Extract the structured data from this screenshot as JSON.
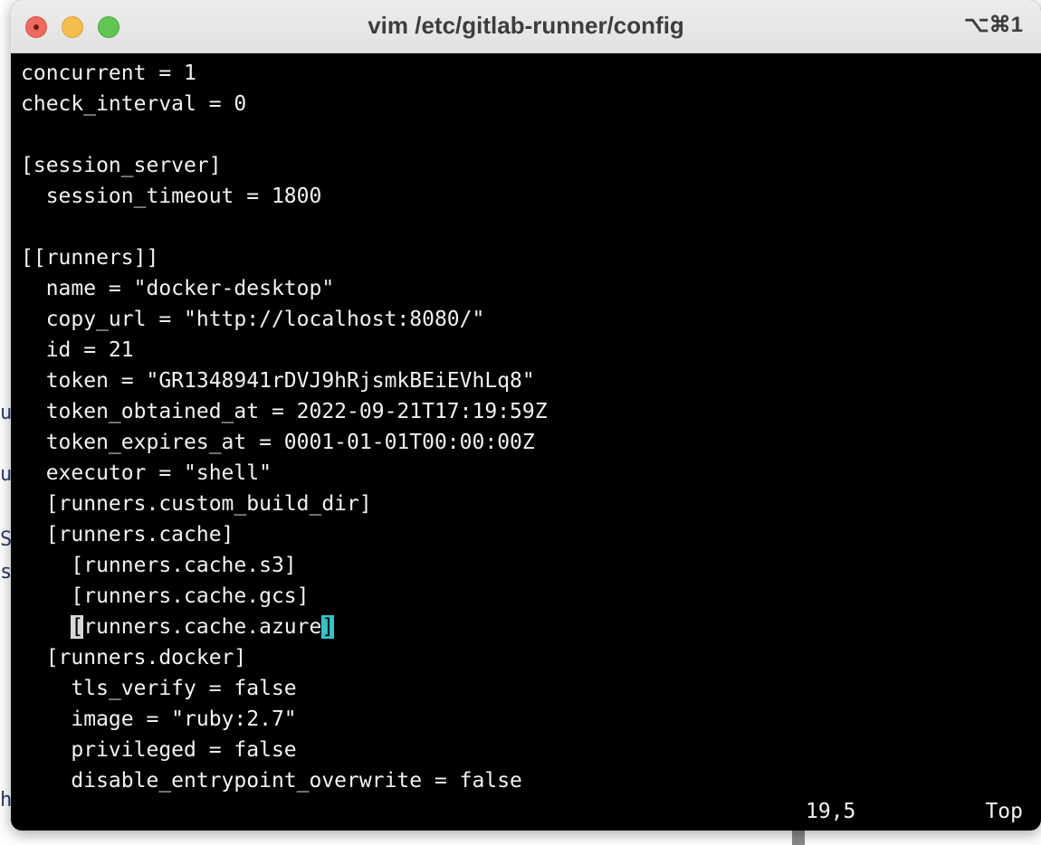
{
  "window": {
    "title": "vim /etc/gitlab-runner/config",
    "shortcut": "⌥⌘1"
  },
  "background": {
    "letters": [
      "u",
      "u",
      "S",
      "s",
      "h"
    ]
  },
  "editor": {
    "lines": [
      "concurrent = 1",
      "check_interval = 0",
      "",
      "[session_server]",
      "  session_timeout = 1800",
      "",
      "[[runners]]",
      "  name = \"docker-desktop\"",
      "  copy_url = \"http://localhost:8080/\"",
      "  id = 21",
      "  token = \"GR1348941rDVJ9hRjsmkBEiEVhLq8\"",
      "  token_obtained_at = 2022-09-21T17:19:59Z",
      "  token_expires_at = 0001-01-01T00:00:00Z",
      "  executor = \"shell\"",
      "  [runners.custom_build_dir]",
      "  [runners.cache]",
      "    [runners.cache.s3]",
      "    [runners.cache.gcs]",
      "",
      "  [runners.docker]",
      "    tls_verify = false",
      "    image = \"ruby:2.7\"",
      "    privileged = false",
      "    disable_entrypoint_overwrite = false"
    ],
    "cursor_line": {
      "indent": "    ",
      "cursor_char": "[",
      "middle": "runners.cache.azure",
      "match_char": "]"
    }
  },
  "status": {
    "position": "19,5",
    "scroll": "Top"
  },
  "colors": {
    "terminal_bg": "#000000",
    "text": "#f2f2f2",
    "cursor": "#d8d8d8",
    "bracket_match": "#36c2c8"
  }
}
